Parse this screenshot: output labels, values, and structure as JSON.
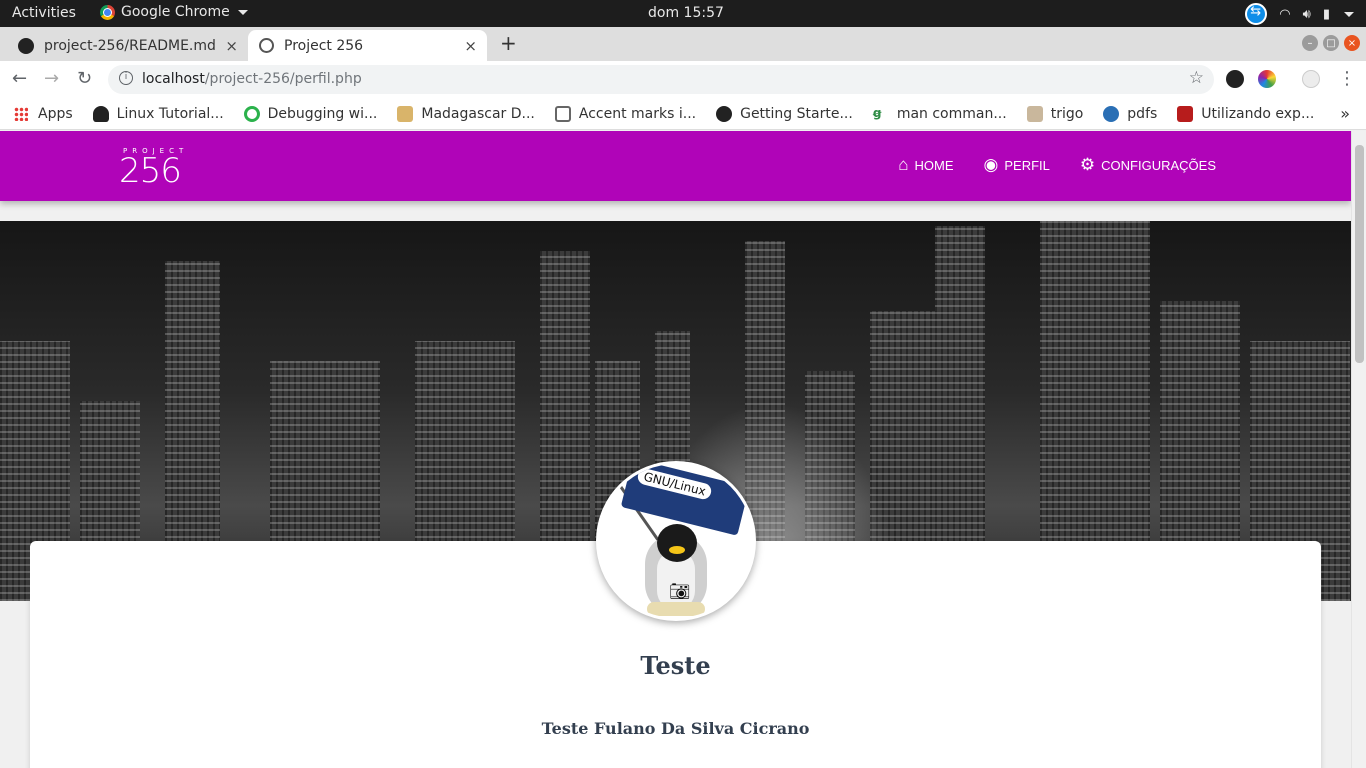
{
  "os": {
    "activities": "Activities",
    "app_name": "Google Chrome",
    "clock": "dom 15:57"
  },
  "tabs": [
    {
      "title": "project-256/README.md",
      "close": "×"
    },
    {
      "title": "Project 256",
      "close": "×"
    }
  ],
  "newtab": "+",
  "address": {
    "host": "localhost",
    "path": "/project-256/perfil.php"
  },
  "bookmarks": [
    {
      "label": "Apps",
      "icon": "apps-grid-icon"
    },
    {
      "label": "Linux Tutorial...",
      "icon": "tux-icon"
    },
    {
      "label": "Debugging wi...",
      "icon": "target-icon"
    },
    {
      "label": "Madagascar D...",
      "icon": "m-icon"
    },
    {
      "label": "Accent marks i...",
      "icon": "bookmark-icon"
    },
    {
      "label": "Getting Starte...",
      "icon": "github-icon"
    },
    {
      "label": "man comman...",
      "icon": "gg-icon"
    },
    {
      "label": "trigo",
      "icon": "table-icon"
    },
    {
      "label": "pdfs",
      "icon": "pdf-icon"
    },
    {
      "label": "Utilizando exp...",
      "icon": "red-square-icon"
    }
  ],
  "site": {
    "logo_small": "PROJECT",
    "logo_big": "256",
    "nav": [
      {
        "label": "HOME",
        "icon": "home-icon"
      },
      {
        "label": "PERFIL",
        "icon": "account-icon"
      },
      {
        "label": "CONFIGURAÇÕES",
        "icon": "gear-icon"
      }
    ]
  },
  "avatar": {
    "flag_text": "GNU/Linux"
  },
  "profile": {
    "username": "Teste",
    "full_name": "Teste Fulano Da Silva Cicrano"
  },
  "colors": {
    "brand": "#b004b8",
    "os_bar": "#1d1d1d",
    "text_dark": "#333f4f"
  }
}
